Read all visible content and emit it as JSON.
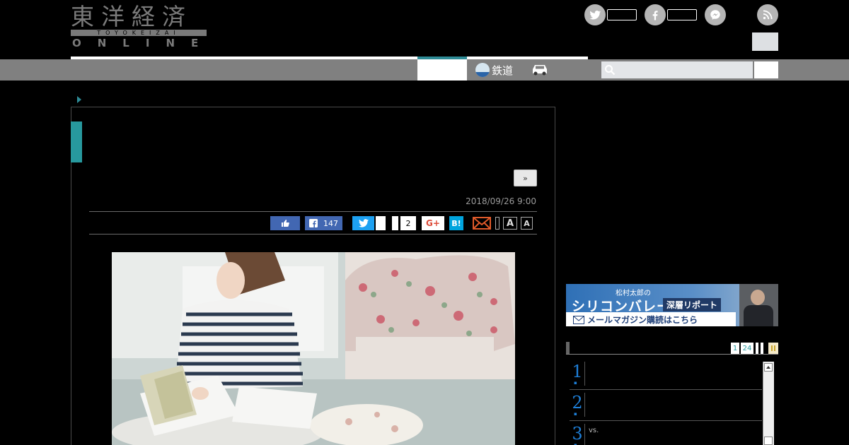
{
  "logo": {
    "kanji": "東洋経済",
    "band": "TOYOKEIZAI",
    "online": "ONLINE"
  },
  "nav": {
    "rail_label": "鉄道"
  },
  "article": {
    "next_label": "»",
    "date": "2018/09/26 9:00"
  },
  "share": {
    "facebook_count": "147",
    "hatena_count": "2",
    "google_label": "G+",
    "hatena_label": "B!",
    "font_large": "A",
    "font_small": "A"
  },
  "banner": {
    "small": "松村太郎の",
    "big": "シリコンバレー",
    "tag": "深層リポート",
    "mail": "メールマガジン購読はこちら"
  },
  "ranking": {
    "pages": [
      "1",
      "24"
    ],
    "items": [
      {
        "num": "1",
        "text": ""
      },
      {
        "num": "2",
        "text": ""
      },
      {
        "num": "3",
        "text": "vs."
      }
    ]
  },
  "colors": {
    "accent": "#27999e",
    "facebook": "#4267b2",
    "twitter": "#1da1f2",
    "hatena": "#00a4de",
    "rank_number": "#1e7fd8"
  }
}
